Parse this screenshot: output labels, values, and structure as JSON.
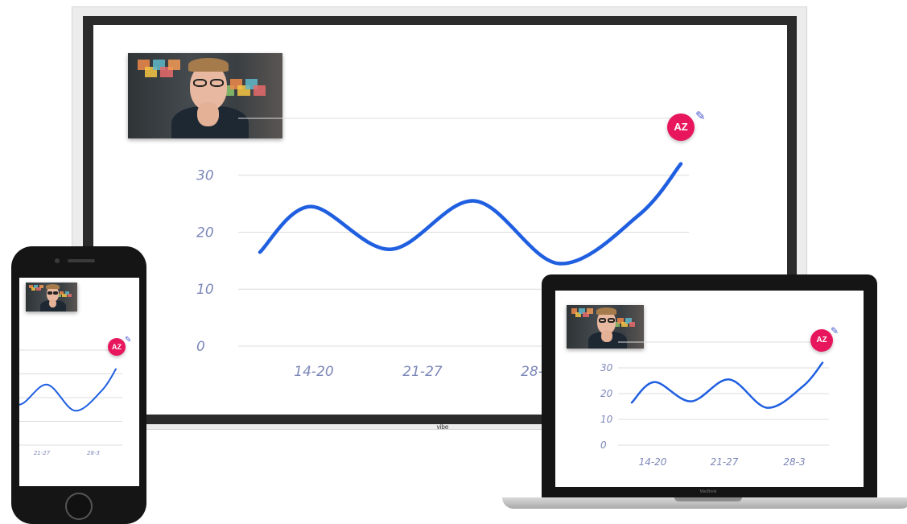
{
  "devices": {
    "whiteboard_brand": "vibe",
    "laptop_brand": "MacBook"
  },
  "participant": {
    "initials": "AZ",
    "avatar_color": "#e8175d",
    "tool_icon": "pencil-icon"
  },
  "video_tile": {
    "icon": "person-video-feed"
  },
  "colors": {
    "line": "#1f5fe0",
    "axis_text": "#7c87b8",
    "grid": "#dcdcdc"
  },
  "chart_data": [
    {
      "device": "whiteboard",
      "type": "line",
      "style": "handwritten",
      "y_ticks": [
        "0",
        "10",
        "20",
        "30"
      ],
      "categories": [
        "14-20",
        "21-27",
        "28-"
      ],
      "ylim": [
        0,
        40
      ],
      "grid": true,
      "series": [
        {
          "x": [
            0,
            0.6,
            1.55,
            2.55,
            3.55,
            4.5,
            5.0
          ],
          "y": [
            16.5,
            24.5,
            17,
            25.5,
            14.5,
            23,
            32
          ]
        }
      ]
    },
    {
      "device": "laptop",
      "type": "line",
      "style": "handwritten",
      "y_ticks": [
        "0",
        "10",
        "20",
        "30"
      ],
      "categories": [
        "14-20",
        "21-27",
        "28-3"
      ],
      "ylim": [
        0,
        40
      ],
      "grid": true,
      "series": [
        {
          "x": [
            0,
            0.6,
            1.55,
            2.55,
            3.55,
            4.5,
            5.0
          ],
          "y": [
            16.5,
            24.5,
            17,
            25.5,
            14.5,
            23,
            32
          ]
        }
      ]
    },
    {
      "device": "phone",
      "type": "line",
      "style": "handwritten",
      "categories": [
        "21-27",
        "28-3"
      ],
      "ylim": [
        0,
        40
      ],
      "grid": true,
      "series": [
        {
          "x": [
            0,
            0.6,
            1.55,
            2.55,
            3.55,
            4.5,
            5.0
          ],
          "y": [
            16.5,
            24.5,
            17,
            25.5,
            14.5,
            23,
            32
          ]
        }
      ]
    }
  ]
}
